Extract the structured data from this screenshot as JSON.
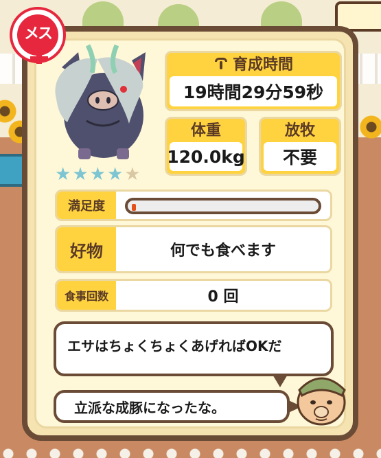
{
  "badge": {
    "gender_label": "メス",
    "color": "#e6273d"
  },
  "pig": {
    "rating_stars": 4,
    "max_stars": 5
  },
  "stats": {
    "growth_time": {
      "label": "育成時間",
      "value": "19時間29分59秒",
      "icon": "timer-icon"
    },
    "weight": {
      "label": "体重",
      "value": "120.0kg"
    },
    "grazing": {
      "label": "放牧",
      "value": "不要"
    }
  },
  "satisfaction": {
    "label": "満足度",
    "level_fraction": 0.02
  },
  "favorite_food": {
    "label": "好物",
    "value": "何でも食べます"
  },
  "meal_count": {
    "label": "食事回数",
    "value": "0 回"
  },
  "farmer_dialog": {
    "line1": "エサはちょくちょくあげればOKだ",
    "line2": "立派な成豚になったな。"
  },
  "colors": {
    "accent_yellow": "#ffd33f",
    "frame_brown": "#6a4b36",
    "panel_cream": "#fff8d8",
    "star_blue": "#7dc5d3"
  }
}
